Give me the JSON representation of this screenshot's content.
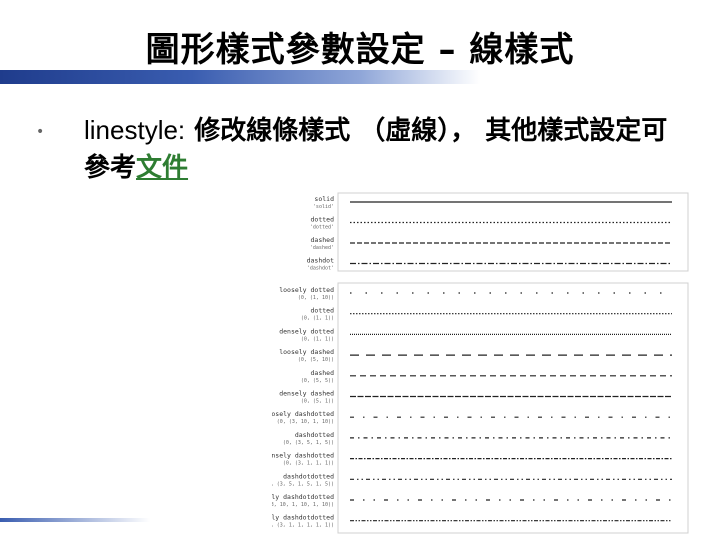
{
  "slide": {
    "title": "圖形樣式參數設定 – 線樣式",
    "bullet": {
      "keyword": "linestyle:",
      "text": " 修改線條樣式 （虛線）， 其他樣式設定可參考",
      "link": "文件"
    }
  },
  "figure": {
    "named_styles": [
      {
        "name": "solid",
        "code": "'solid'",
        "dash": ""
      },
      {
        "name": "dotted",
        "code": "'dotted'",
        "dash": "1.5 2"
      },
      {
        "name": "dashed",
        "code": "'dashed'",
        "dash": "5 2"
      },
      {
        "name": "dashdot",
        "code": "'dashdot'",
        "dash": "6 2 1.5 2"
      }
    ],
    "parametrized_styles": [
      {
        "name": "loosely dotted",
        "code": "(0, (1, 10))",
        "dash": "1.5 14"
      },
      {
        "name": "dotted",
        "code": "(0, (1, 1))",
        "dash": "1.5 1.5"
      },
      {
        "name": "densely dotted",
        "code": "(0, (1, 1))",
        "dash": "1 1"
      },
      {
        "name": "loosely dashed",
        "code": "(0, (5, 10))",
        "dash": "9 7"
      },
      {
        "name": "dashed",
        "code": "(0, (5, 5))",
        "dash": "6 4"
      },
      {
        "name": "densely dashed",
        "code": "(0, (5, 1))",
        "dash": "6 1.5"
      },
      {
        "name": "loosely dashdotted",
        "code": "(0, (3, 10, 1, 10))",
        "dash": "4 9 1.5 9"
      },
      {
        "name": "dashdotted",
        "code": "(0, (3, 5, 1, 5))",
        "dash": "4 4 1.5 4"
      },
      {
        "name": "densely dashdotted",
        "code": "(0, (3, 1, 1, 1))",
        "dash": "4 1.5 1.5 1.5"
      },
      {
        "name": "dashdotdotted",
        "code": "(0, (3, 5, 1, 5, 1, 5))",
        "dash": "4 3 1.5 3 1.5 3"
      },
      {
        "name": "loosely dashdotdotted",
        "code": "(0, (3, 10, 1, 10, 1, 10))",
        "dash": "4 9 1.5 9 1.5 9"
      },
      {
        "name": "densely dashdotdotted",
        "code": "(0, (3, 1, 1, 1, 1, 1))",
        "dash": "4 1.5 1.5 1.5 1.5 1.5"
      }
    ]
  }
}
